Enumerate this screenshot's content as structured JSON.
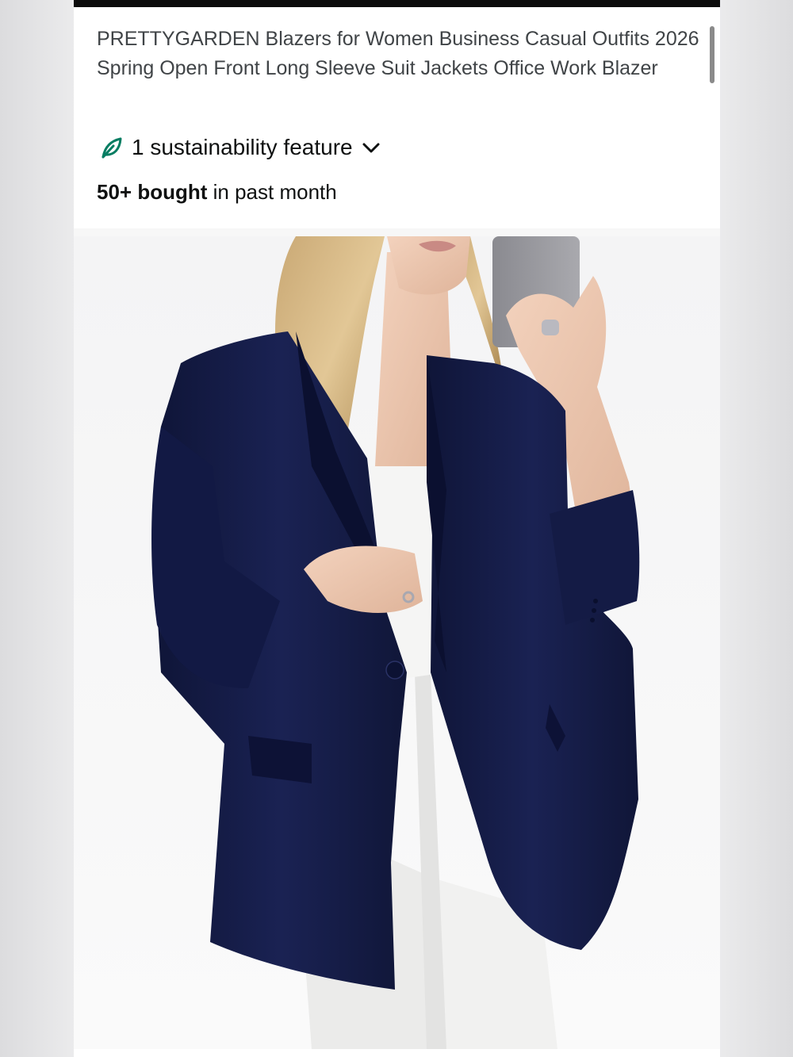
{
  "product": {
    "title": "PRETTYGARDEN Blazers for Women Business Casual Outfits 2026 Spring Open Front Long Sleeve Suit Jackets Office Work Blazer",
    "sustainability": {
      "label": "1 sustainability feature",
      "icon": "leaf-icon",
      "toggle_icon": "chevron-down-icon",
      "accent_color": "#067d62"
    },
    "purchase_stat": {
      "count": "50+ bought",
      "suffix": " in past month"
    },
    "image": {
      "subject": "navy-blazer-mirror-selfie",
      "blazer_color": "#141c45"
    }
  }
}
